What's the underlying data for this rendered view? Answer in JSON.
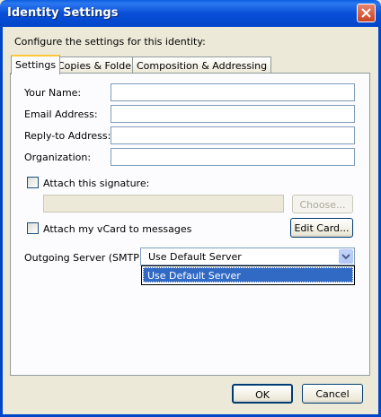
{
  "window": {
    "title": "Identity Settings"
  },
  "intro_text": "Configure the settings for this identity:",
  "tabs": [
    {
      "label": "Settings",
      "active": true
    },
    {
      "label": "Copies & Folders",
      "active": false
    },
    {
      "label": "Composition & Addressing",
      "active": false
    }
  ],
  "form": {
    "your_name_label": "Your Name:",
    "email_label": "Email Address:",
    "reply_to_label": "Reply-to Address:",
    "organization_label": "Organization:",
    "your_name_value": "",
    "email_value": "",
    "reply_to_value": "",
    "organization_value": "",
    "attach_signature_label": "Attach this signature:",
    "attach_signature_checked": false,
    "signature_path_value": "",
    "choose_button": "Choose...",
    "attach_vcard_label": "Attach my vCard to messages",
    "attach_vcard_checked": false,
    "edit_card_button": "Edit Card...",
    "outgoing_server_label": "Outgoing Server (SMTP):",
    "outgoing_server_value": "Use Default Server",
    "outgoing_server_options": [
      "Use Default Server"
    ]
  },
  "buttons": {
    "ok": "OK",
    "cancel": "Cancel"
  },
  "colors": {
    "titlebar": "#0a4fd8",
    "selection": "#316ac5",
    "dialog_bg": "#ece9d8"
  },
  "icons": {
    "close": "close-icon",
    "dropdown": "chevron-down-icon"
  }
}
